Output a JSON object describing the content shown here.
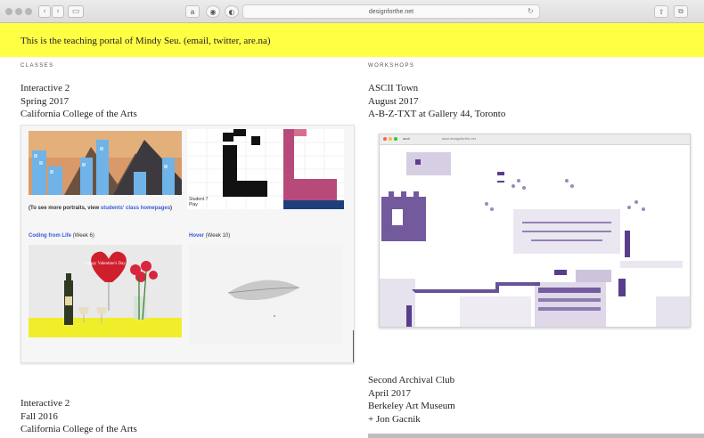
{
  "browser": {
    "url": "designforthe.net",
    "icons": [
      "close-dot",
      "minimize-dot",
      "zoom-dot",
      "back-icon",
      "forward-icon",
      "sidebar-icon",
      "amazon-icon",
      "extension-icon",
      "privacy-icon",
      "reload-icon",
      "share-icon",
      "tabs-icon"
    ]
  },
  "banner": {
    "text": "This is the teaching portal of  Mindy Seu. (email, twitter, are.na)",
    "background": "#ffff44"
  },
  "classes": {
    "heading": "CLASSES",
    "entries": [
      {
        "title": "Interactive 2",
        "term": "Spring 2017",
        "place": "California College of the Arts"
      },
      {
        "title": "Interactive 2",
        "term": "Fall 2016",
        "place": "California College of the Arts"
      }
    ],
    "screenshot": {
      "caption_prefix": "(To see more portraits, view ",
      "caption_link": "students' class homepages",
      "caption_suffix": ")",
      "student_label": "Student 7",
      "student_sub": "Play",
      "card1_link": "Coding from Life",
      "card1_week": " (Week 6)",
      "card2_link": "Hover",
      "card2_week": " (Week 10)",
      "balloon_text": "Happy Valentine's Day"
    }
  },
  "workshops": {
    "heading": "WORKSHOPS",
    "entries": [
      {
        "title": "ASCII Town",
        "term": "August 2017",
        "place": "A-B-Z-TXT at Gallery 44, Toronto"
      },
      {
        "title": "Second Archival Club",
        "term": "April 2017",
        "place": "Berkeley Art Museum",
        "extra": "+ Jon Gacnik"
      }
    ],
    "screenshot": {
      "tab_label": "ascii",
      "url": "ascii.designforthe.net"
    }
  },
  "colors": {
    "link": "#3b5bd6",
    "ascii_purple": "#5a3d8c",
    "banner": "#ffff44"
  }
}
